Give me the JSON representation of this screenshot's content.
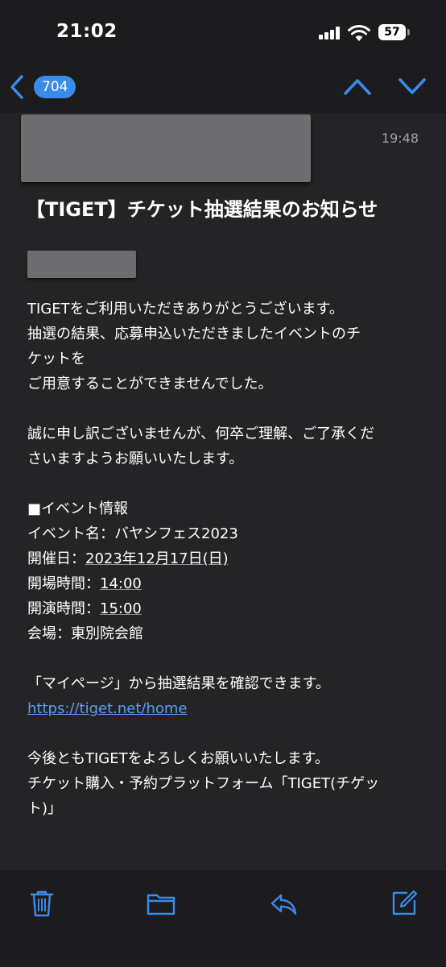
{
  "status_bar": {
    "time": "21:02",
    "battery": "57"
  },
  "nav": {
    "unread_count": "704"
  },
  "mail": {
    "time": "19:48",
    "subject": "【TIGET】チケット抽選結果のお知らせ",
    "paragraphs": [
      [
        "TIGETをご利用いただきありがとうございます。",
        "抽選の結果、応募申込いただきましたイベントのチ",
        "ケットを",
        "ご用意することができませんでした。"
      ],
      [
        "誠に申し訳ございませんが、何卒ご理解、ご了承くだ",
        "さいますようお願いいたします。"
      ]
    ],
    "event": {
      "header": "■イベント情報",
      "name_label": "イベント名：",
      "name": "バヤシフェス2023",
      "date_label": "開催日：",
      "date": "2023年12月17日(日)",
      "open_label": "開場時間：",
      "open": "14:00",
      "start_label": "開演時間：",
      "start": "15:00",
      "venue_label": "会場：",
      "venue": "東別院会館"
    },
    "mypage_text": "「マイページ」から抽選結果を確認できます。",
    "link": "https://tiget.net/home",
    "closing": [
      "今後ともTIGETをよろしくお願いいたします。",
      "チケット購入・予約プラットフォーム「TIGET(チゲッ",
      "ト)」"
    ]
  },
  "colors": {
    "accent": "#3a8bea",
    "background": "#242426",
    "bars": "#1c1c1e",
    "link": "#5b9cf0"
  },
  "icons": [
    "back-icon",
    "up-arrow-icon",
    "down-arrow-icon",
    "trash-icon",
    "folder-icon",
    "reply-icon",
    "compose-icon"
  ]
}
